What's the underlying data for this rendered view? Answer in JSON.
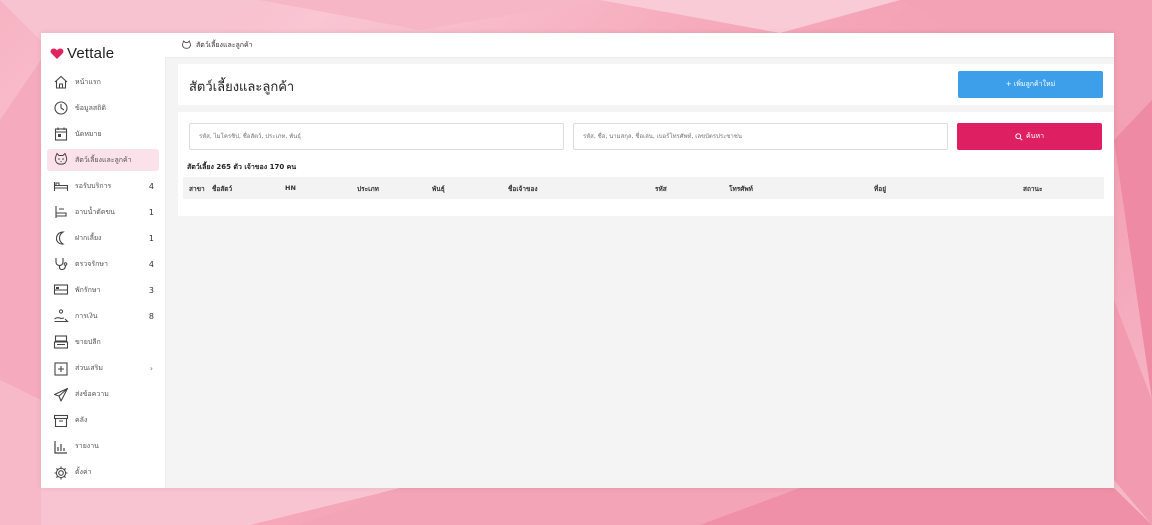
{
  "app": {
    "brand": "Vettale",
    "brand_color": "#e0245e"
  },
  "sidebar": {
    "items": [
      {
        "label": "หน้าแรก",
        "icon": "home-icon",
        "count": ""
      },
      {
        "label": "ข้อมูลสถิติ",
        "icon": "stats-icon",
        "count": ""
      },
      {
        "label": "นัดหมาย",
        "icon": "calendar-icon",
        "count": ""
      },
      {
        "label": "สัตว์เลี้ยงและลูกค้า",
        "icon": "pet-icon",
        "count": "",
        "active": true
      },
      {
        "label": "รอรับบริการ",
        "icon": "bed-icon",
        "count": "4"
      },
      {
        "label": "อาบน้ำตัดขน",
        "icon": "grooming-icon",
        "count": "1"
      },
      {
        "label": "ฝากเลี้ยง",
        "icon": "moon-icon",
        "count": "1"
      },
      {
        "label": "ตรวจรักษา",
        "icon": "stethoscope-icon",
        "count": "4"
      },
      {
        "label": "พักรักษา",
        "icon": "hospital-bed-icon",
        "count": "3"
      },
      {
        "label": "การเงิน",
        "icon": "payment-icon",
        "count": "8"
      },
      {
        "label": "ขายปลีก",
        "icon": "register-icon",
        "count": ""
      },
      {
        "label": "ส่วนเสริม",
        "icon": "plus-box-icon",
        "count": "",
        "chevron": "›"
      },
      {
        "label": "ส่งข้อความ",
        "icon": "send-icon",
        "count": ""
      },
      {
        "label": "คลัง",
        "icon": "archive-icon",
        "count": ""
      },
      {
        "label": "รายงาน",
        "icon": "report-icon",
        "count": ""
      },
      {
        "label": "ตั้งค่า",
        "icon": "settings-icon",
        "count": ""
      }
    ]
  },
  "topbar": {
    "breadcrumb": "สัตว์เลี้ยงและลูกค้า",
    "icon": "pet-icon"
  },
  "header": {
    "title": "สัตว์เลี้ยงและลูกค้า",
    "add_button": "+ เพิ่มลูกค้าใหม่"
  },
  "search": {
    "pet_placeholder": "รหัส, ไมโครชิป, ชื่อสัตว์, ประเภท, พันธุ์",
    "owner_placeholder": "รหัส, ชื่อ, นามสกุล, ชื่อเล่น, เบอร์โทรศัพท์, เลขบัตรประชาชน",
    "button": "ค้นหา",
    "button_color": "#de1f62"
  },
  "summary": {
    "text": "สัตว์เลี้ยง 265 ตัว    เจ้าของ 170 คน"
  },
  "table": {
    "columns": [
      "สาขา",
      "ชื่อสัตว์",
      "HN",
      "ประเภท",
      "พันธุ์",
      "ชื่อเจ้าของ",
      "รหัส",
      "โทรศัพท์",
      "ที่อยู่",
      "สถานะ"
    ]
  }
}
